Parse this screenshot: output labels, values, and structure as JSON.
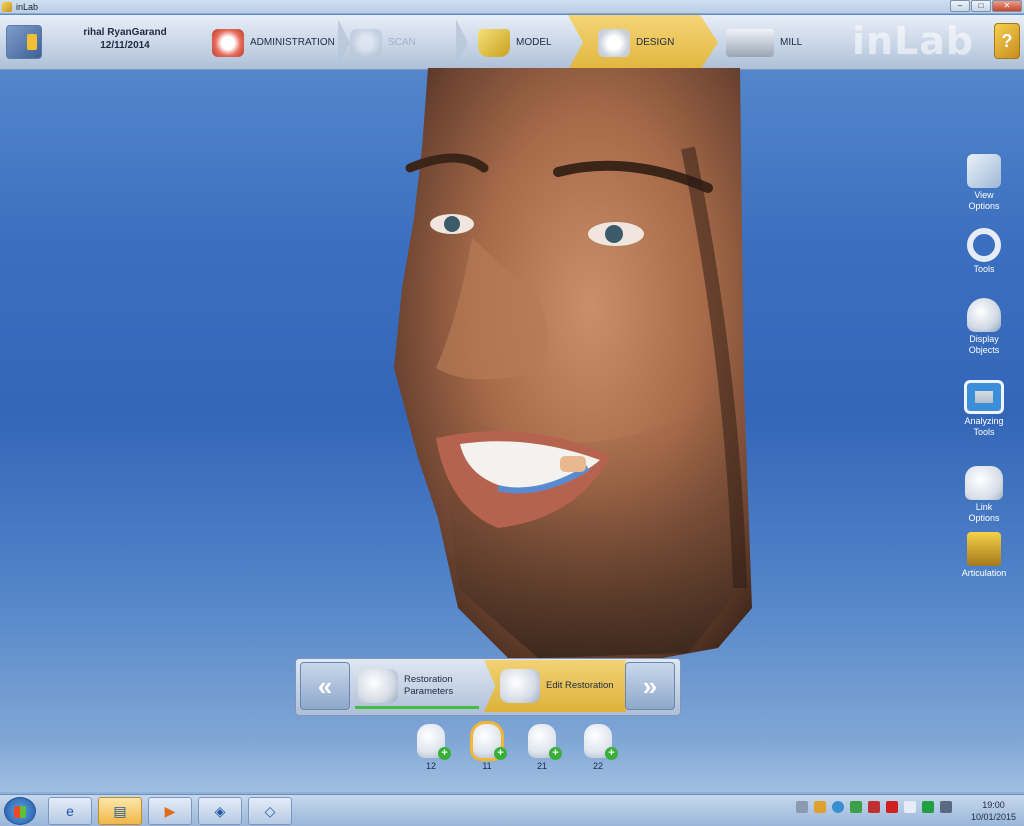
{
  "window": {
    "title": "inLab",
    "buttons": {
      "minimize": "–",
      "maximize": "□",
      "close": "✕"
    }
  },
  "patient": {
    "name": "rihal RyanGarand",
    "date": "12/11/2014"
  },
  "workflow": {
    "steps": [
      {
        "label": "ADMINISTRATION",
        "state": "normal"
      },
      {
        "label": "SCAN",
        "state": "disabled"
      },
      {
        "label": "MODEL",
        "state": "normal"
      },
      {
        "label": "DESIGN",
        "state": "active"
      },
      {
        "label": "MILL",
        "state": "normal"
      }
    ],
    "brand": "inLab",
    "help_glyph": "?"
  },
  "tools": [
    {
      "label_line1": "View",
      "label_line2": "Options",
      "icon": "cube-icon"
    },
    {
      "label_line1": "Tools",
      "label_line2": "",
      "icon": "ring-tool-icon"
    },
    {
      "label_line1": "Display",
      "label_line2": "Objects",
      "icon": "display-objects-icon"
    },
    {
      "label_line1": "Analyzing",
      "label_line2": "Tools",
      "icon": "monitor-icon"
    },
    {
      "label_line1": "Link",
      "label_line2": "Options",
      "icon": "teeth-link-icon"
    },
    {
      "label_line1": "Articulation",
      "label_line2": "",
      "icon": "articulator-icon"
    }
  ],
  "phase_panel": {
    "prev_glyph": "«",
    "next_glyph": "»",
    "steps": [
      {
        "line1": "Restoration",
        "line2": "Parameters",
        "state": "done"
      },
      {
        "line1": "Edit Restoration",
        "line2": "",
        "state": "active"
      }
    ]
  },
  "teeth": [
    {
      "number": "12",
      "selected": false
    },
    {
      "number": "11",
      "selected": true
    },
    {
      "number": "21",
      "selected": false
    },
    {
      "number": "22",
      "selected": false
    }
  ],
  "taskbar": {
    "items": [
      {
        "icon": "ie-icon",
        "glyph": "e"
      },
      {
        "icon": "folder-icon",
        "glyph": "▤"
      },
      {
        "icon": "media-player-icon",
        "glyph": "▶"
      },
      {
        "icon": "cerec-app-icon",
        "glyph": "◈"
      },
      {
        "icon": "inlab-app-icon",
        "glyph": "◇"
      }
    ],
    "clock_time": "19:00",
    "clock_date": "10/01/2015"
  },
  "colors": {
    "active_step": "#e1b63e",
    "background": "#3466b8",
    "progress": "#3fbf3f"
  }
}
